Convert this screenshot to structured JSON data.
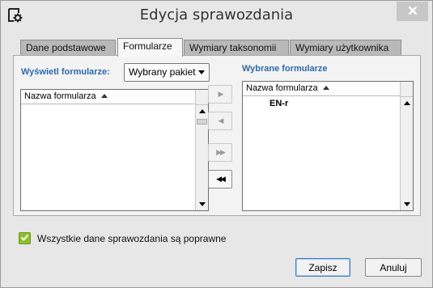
{
  "window": {
    "title": "Edycja sprawozdania",
    "close_icon": "close-icon",
    "app_icon": "settings-document-icon"
  },
  "tabs": [
    {
      "label": "Dane podstawowe",
      "active": false
    },
    {
      "label": "Formularze",
      "active": true
    },
    {
      "label": "Wymiary taksonomii",
      "active": false
    },
    {
      "label": "Wymiary użytkownika",
      "active": false
    }
  ],
  "left": {
    "filter_label": "Wyświetl formularze:",
    "filter_value": "Wybrany pakiet",
    "list_header": "Nazwa formularza",
    "rows": []
  },
  "right": {
    "title": "Wybrane formularze",
    "list_header": "Nazwa formularza",
    "rows": [
      "EN-r"
    ]
  },
  "move_buttons": {
    "add_one": "▶",
    "remove_one": "◀",
    "add_all": "▶▶",
    "remove_all": "◀◀"
  },
  "validation": {
    "checked": true,
    "label": "Wszystkie dane sprawozdania są poprawne"
  },
  "footer": {
    "save_label": "Zapisz",
    "cancel_label": "Anuluj"
  },
  "colors": {
    "accent_label": "#2f6aa9",
    "check_green": "#8cbf2c",
    "default_button_border": "#3f7fc0"
  }
}
